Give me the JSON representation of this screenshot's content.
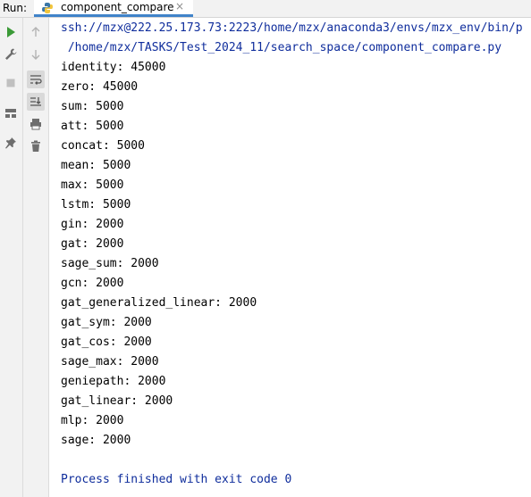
{
  "run_panel": {
    "label": "Run:",
    "tab": {
      "title": "component_compare",
      "icon": "python-icon",
      "close_glyph": "×"
    }
  },
  "toolbar_left": [
    {
      "icon": "run-icon",
      "color": "#3b9a37"
    },
    {
      "icon": "wrench-icon"
    },
    {
      "icon": "stop-icon"
    },
    {
      "icon": "layout-icon"
    },
    {
      "icon": "pin-icon"
    }
  ],
  "toolbar_right": [
    {
      "icon": "up-arrow-icon"
    },
    {
      "icon": "down-arrow-icon"
    },
    {
      "icon": "soft-wrap-icon",
      "active": true
    },
    {
      "icon": "scroll-to-end-icon",
      "active": true
    },
    {
      "icon": "print-icon"
    },
    {
      "icon": "trash-icon"
    }
  ],
  "console": {
    "command_line_1": "ssh://mzx@222.25.173.73:2223/home/mzx/anaconda3/envs/mzx_env/bin/p",
    "command_line_2": " /home/mzx/TASKS/Test_2024_11/search_space/component_compare.py",
    "output": [
      "identity: 45000",
      "zero: 45000",
      "sum: 5000",
      "att: 5000",
      "concat: 5000",
      "mean: 5000",
      "max: 5000",
      "lstm: 5000",
      "gin: 2000",
      "gat: 2000",
      "sage_sum: 2000",
      "gcn: 2000",
      "gat_generalized_linear: 2000",
      "gat_sym: 2000",
      "gat_cos: 2000",
      "sage_max: 2000",
      "geniepath: 2000",
      "gat_linear: 2000",
      "mlp: 2000",
      "sage: 2000"
    ],
    "process_message": "Process finished with exit code 0"
  },
  "colors": {
    "command_text": "#0f2d9c",
    "output_text": "#000000",
    "tab_underline": "#4083c9",
    "panel_bg": "#f2f2f2"
  }
}
